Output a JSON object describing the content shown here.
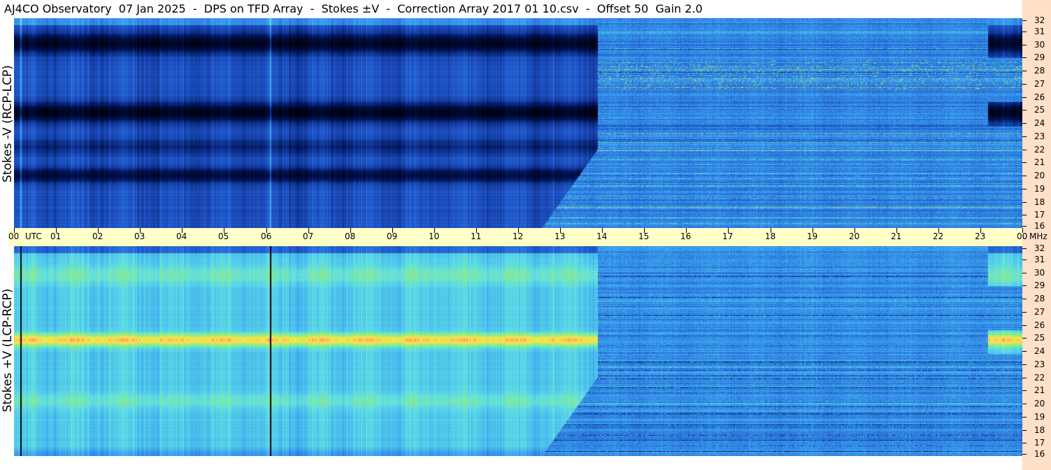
{
  "title": "AJ4CO Observatory  07 Jan 2025  -  DPS on TFD Array  -  Stokes ±V  -  Correction Array 2017 01 10.csv  -  Offset 50  Gain 2.0",
  "colors": {
    "freq_axis_bg": "#ffe0c8",
    "time_axis_bg": "#ffffc8",
    "colormap": [
      "#000010",
      "#00155a",
      "#1f53c8",
      "#3aa0f0",
      "#5fe0e6",
      "#a0f060",
      "#ffe650",
      "#ff6080"
    ]
  },
  "chart_data": {
    "type": "heatmap",
    "title": "AJ4CO Observatory  07 Jan 2025  -  DPS on TFD Array  -  Stokes ±V  -  Correction Array 2017 01 10.csv  -  Offset 50  Gain 2.0",
    "x_axis": {
      "unit": "UTC",
      "range": [
        0,
        24
      ],
      "tick_labels": [
        "00",
        "01",
        "02",
        "03",
        "04",
        "05",
        "06",
        "07",
        "08",
        "09",
        "10",
        "11",
        "12",
        "13",
        "14",
        "15",
        "16",
        "17",
        "18",
        "19",
        "20",
        "21",
        "22",
        "23",
        "00"
      ]
    },
    "y_axis": {
      "unit": "MHz",
      "range": [
        16,
        32
      ],
      "tick_labels": [
        "16",
        "17",
        "18",
        "19",
        "20",
        "21",
        "22",
        "23",
        "24",
        "25",
        "26",
        "27",
        "28",
        "29",
        "30",
        "31",
        "32"
      ]
    },
    "panels": [
      {
        "ylabel": "Stokes -V (RCP-LCP)",
        "description_features": {
          "dark_bands_mhz": [
            [
              24,
              25.6
            ],
            [
              19.6,
              20.4
            ],
            [
              29.5,
              30.8
            ]
          ],
          "dark_until_utc": 14,
          "vertical_lines_utc": [
            0.15,
            6.1
          ]
        }
      },
      {
        "ylabel": "Stokes +V (LCP-RCP)",
        "description_features": {
          "bright_band_mhz": [
            24.4,
            25.3
          ],
          "bright_until_utc": 13.9,
          "vertical_lines_utc": [
            0.15,
            6.1
          ]
        }
      }
    ]
  },
  "axis_units": {
    "time": "UTC",
    "freq": "MHz"
  }
}
